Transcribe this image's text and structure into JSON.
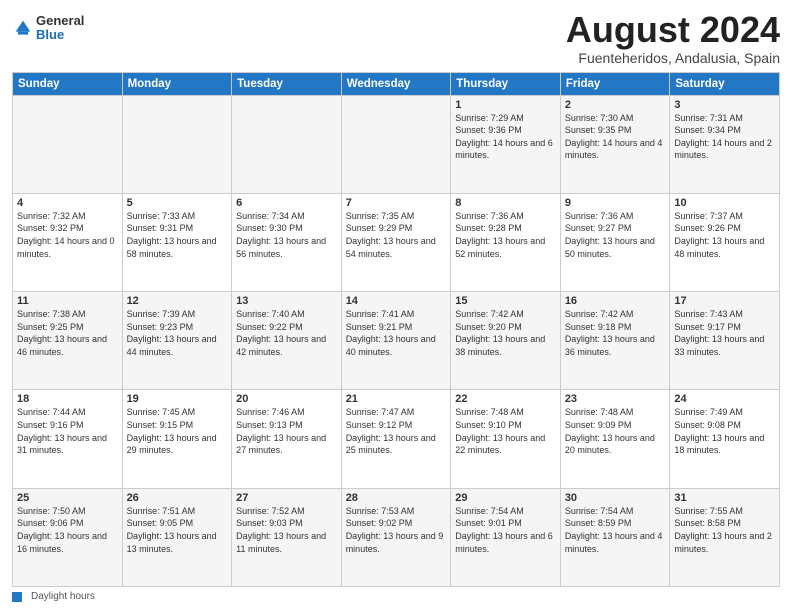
{
  "header": {
    "logo_general": "General",
    "logo_blue": "Blue",
    "month_year": "August 2024",
    "location": "Fuenteheridos, Andalusia, Spain"
  },
  "days_of_week": [
    "Sunday",
    "Monday",
    "Tuesday",
    "Wednesday",
    "Thursday",
    "Friday",
    "Saturday"
  ],
  "weeks": [
    [
      {
        "day": "",
        "sunrise": "",
        "sunset": "",
        "daylight": ""
      },
      {
        "day": "",
        "sunrise": "",
        "sunset": "",
        "daylight": ""
      },
      {
        "day": "",
        "sunrise": "",
        "sunset": "",
        "daylight": ""
      },
      {
        "day": "",
        "sunrise": "",
        "sunset": "",
        "daylight": ""
      },
      {
        "day": "1",
        "sunrise": "Sunrise: 7:29 AM",
        "sunset": "Sunset: 9:36 PM",
        "daylight": "Daylight: 14 hours and 6 minutes."
      },
      {
        "day": "2",
        "sunrise": "Sunrise: 7:30 AM",
        "sunset": "Sunset: 9:35 PM",
        "daylight": "Daylight: 14 hours and 4 minutes."
      },
      {
        "day": "3",
        "sunrise": "Sunrise: 7:31 AM",
        "sunset": "Sunset: 9:34 PM",
        "daylight": "Daylight: 14 hours and 2 minutes."
      }
    ],
    [
      {
        "day": "4",
        "sunrise": "Sunrise: 7:32 AM",
        "sunset": "Sunset: 9:32 PM",
        "daylight": "Daylight: 14 hours and 0 minutes."
      },
      {
        "day": "5",
        "sunrise": "Sunrise: 7:33 AM",
        "sunset": "Sunset: 9:31 PM",
        "daylight": "Daylight: 13 hours and 58 minutes."
      },
      {
        "day": "6",
        "sunrise": "Sunrise: 7:34 AM",
        "sunset": "Sunset: 9:30 PM",
        "daylight": "Daylight: 13 hours and 56 minutes."
      },
      {
        "day": "7",
        "sunrise": "Sunrise: 7:35 AM",
        "sunset": "Sunset: 9:29 PM",
        "daylight": "Daylight: 13 hours and 54 minutes."
      },
      {
        "day": "8",
        "sunrise": "Sunrise: 7:36 AM",
        "sunset": "Sunset: 9:28 PM",
        "daylight": "Daylight: 13 hours and 52 minutes."
      },
      {
        "day": "9",
        "sunrise": "Sunrise: 7:36 AM",
        "sunset": "Sunset: 9:27 PM",
        "daylight": "Daylight: 13 hours and 50 minutes."
      },
      {
        "day": "10",
        "sunrise": "Sunrise: 7:37 AM",
        "sunset": "Sunset: 9:26 PM",
        "daylight": "Daylight: 13 hours and 48 minutes."
      }
    ],
    [
      {
        "day": "11",
        "sunrise": "Sunrise: 7:38 AM",
        "sunset": "Sunset: 9:25 PM",
        "daylight": "Daylight: 13 hours and 46 minutes."
      },
      {
        "day": "12",
        "sunrise": "Sunrise: 7:39 AM",
        "sunset": "Sunset: 9:23 PM",
        "daylight": "Daylight: 13 hours and 44 minutes."
      },
      {
        "day": "13",
        "sunrise": "Sunrise: 7:40 AM",
        "sunset": "Sunset: 9:22 PM",
        "daylight": "Daylight: 13 hours and 42 minutes."
      },
      {
        "day": "14",
        "sunrise": "Sunrise: 7:41 AM",
        "sunset": "Sunset: 9:21 PM",
        "daylight": "Daylight: 13 hours and 40 minutes."
      },
      {
        "day": "15",
        "sunrise": "Sunrise: 7:42 AM",
        "sunset": "Sunset: 9:20 PM",
        "daylight": "Daylight: 13 hours and 38 minutes."
      },
      {
        "day": "16",
        "sunrise": "Sunrise: 7:42 AM",
        "sunset": "Sunset: 9:18 PM",
        "daylight": "Daylight: 13 hours and 36 minutes."
      },
      {
        "day": "17",
        "sunrise": "Sunrise: 7:43 AM",
        "sunset": "Sunset: 9:17 PM",
        "daylight": "Daylight: 13 hours and 33 minutes."
      }
    ],
    [
      {
        "day": "18",
        "sunrise": "Sunrise: 7:44 AM",
        "sunset": "Sunset: 9:16 PM",
        "daylight": "Daylight: 13 hours and 31 minutes."
      },
      {
        "day": "19",
        "sunrise": "Sunrise: 7:45 AM",
        "sunset": "Sunset: 9:15 PM",
        "daylight": "Daylight: 13 hours and 29 minutes."
      },
      {
        "day": "20",
        "sunrise": "Sunrise: 7:46 AM",
        "sunset": "Sunset: 9:13 PM",
        "daylight": "Daylight: 13 hours and 27 minutes."
      },
      {
        "day": "21",
        "sunrise": "Sunrise: 7:47 AM",
        "sunset": "Sunset: 9:12 PM",
        "daylight": "Daylight: 13 hours and 25 minutes."
      },
      {
        "day": "22",
        "sunrise": "Sunrise: 7:48 AM",
        "sunset": "Sunset: 9:10 PM",
        "daylight": "Daylight: 13 hours and 22 minutes."
      },
      {
        "day": "23",
        "sunrise": "Sunrise: 7:48 AM",
        "sunset": "Sunset: 9:09 PM",
        "daylight": "Daylight: 13 hours and 20 minutes."
      },
      {
        "day": "24",
        "sunrise": "Sunrise: 7:49 AM",
        "sunset": "Sunset: 9:08 PM",
        "daylight": "Daylight: 13 hours and 18 minutes."
      }
    ],
    [
      {
        "day": "25",
        "sunrise": "Sunrise: 7:50 AM",
        "sunset": "Sunset: 9:06 PM",
        "daylight": "Daylight: 13 hours and 16 minutes."
      },
      {
        "day": "26",
        "sunrise": "Sunrise: 7:51 AM",
        "sunset": "Sunset: 9:05 PM",
        "daylight": "Daylight: 13 hours and 13 minutes."
      },
      {
        "day": "27",
        "sunrise": "Sunrise: 7:52 AM",
        "sunset": "Sunset: 9:03 PM",
        "daylight": "Daylight: 13 hours and 11 minutes."
      },
      {
        "day": "28",
        "sunrise": "Sunrise: 7:53 AM",
        "sunset": "Sunset: 9:02 PM",
        "daylight": "Daylight: 13 hours and 9 minutes."
      },
      {
        "day": "29",
        "sunrise": "Sunrise: 7:54 AM",
        "sunset": "Sunset: 9:01 PM",
        "daylight": "Daylight: 13 hours and 6 minutes."
      },
      {
        "day": "30",
        "sunrise": "Sunrise: 7:54 AM",
        "sunset": "Sunset: 8:59 PM",
        "daylight": "Daylight: 13 hours and 4 minutes."
      },
      {
        "day": "31",
        "sunrise": "Sunrise: 7:55 AM",
        "sunset": "Sunset: 8:58 PM",
        "daylight": "Daylight: 13 hours and 2 minutes."
      }
    ]
  ],
  "footer": {
    "daylight_label": "Daylight hours"
  }
}
